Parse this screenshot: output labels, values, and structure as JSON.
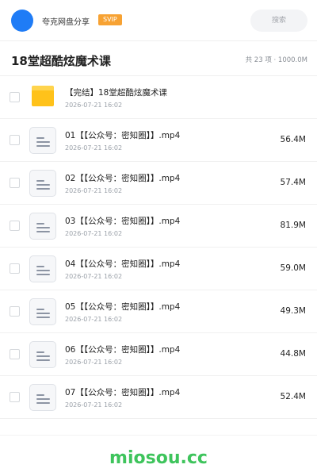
{
  "header": {
    "owner_name": "夸克网盘分享",
    "badge": "SVIP",
    "search_placeholder": "搜索",
    "accent_color": "#1f7cf6",
    "badge_color": "#f7a233"
  },
  "share": {
    "title": "18堂超酷炫魔术课",
    "summary": "共 23 项 · 1000.0M"
  },
  "files": [
    {
      "type": "folder",
      "icon": "folder-icon",
      "name": "【完结】18堂超酷炫魔术课",
      "date": "2026-07-21 16:02",
      "size": ""
    },
    {
      "type": "file",
      "icon": "document-icon",
      "name": "01【【公众号：密知圈】】.mp4",
      "date": "2026-07-21 16:02",
      "size": "56.4M"
    },
    {
      "type": "file",
      "icon": "document-icon",
      "name": "02【【公众号：密知圈】】.mp4",
      "date": "2026-07-21 16:02",
      "size": "57.4M"
    },
    {
      "type": "file",
      "icon": "document-icon",
      "name": "03【【公众号：密知圈】】.mp4",
      "date": "2026-07-21 16:02",
      "size": "81.9M"
    },
    {
      "type": "file",
      "icon": "document-icon",
      "name": "04【【公众号：密知圈】】.mp4",
      "date": "2026-07-21 16:02",
      "size": "59.0M"
    },
    {
      "type": "file",
      "icon": "document-icon",
      "name": "05【【公众号：密知圈】】.mp4",
      "date": "2026-07-21 16:02",
      "size": "49.3M"
    },
    {
      "type": "file",
      "icon": "document-icon",
      "name": "06【【公众号：密知圈】】.mp4",
      "date": "2026-07-21 16:02",
      "size": "44.8M"
    },
    {
      "type": "file",
      "icon": "document-icon",
      "name": "07【【公众号：密知圈】】.mp4",
      "date": "2026-07-21 16:02",
      "size": "52.4M"
    }
  ],
  "watermark": {
    "text": "miosou.cc",
    "color": "#3ec45c"
  }
}
